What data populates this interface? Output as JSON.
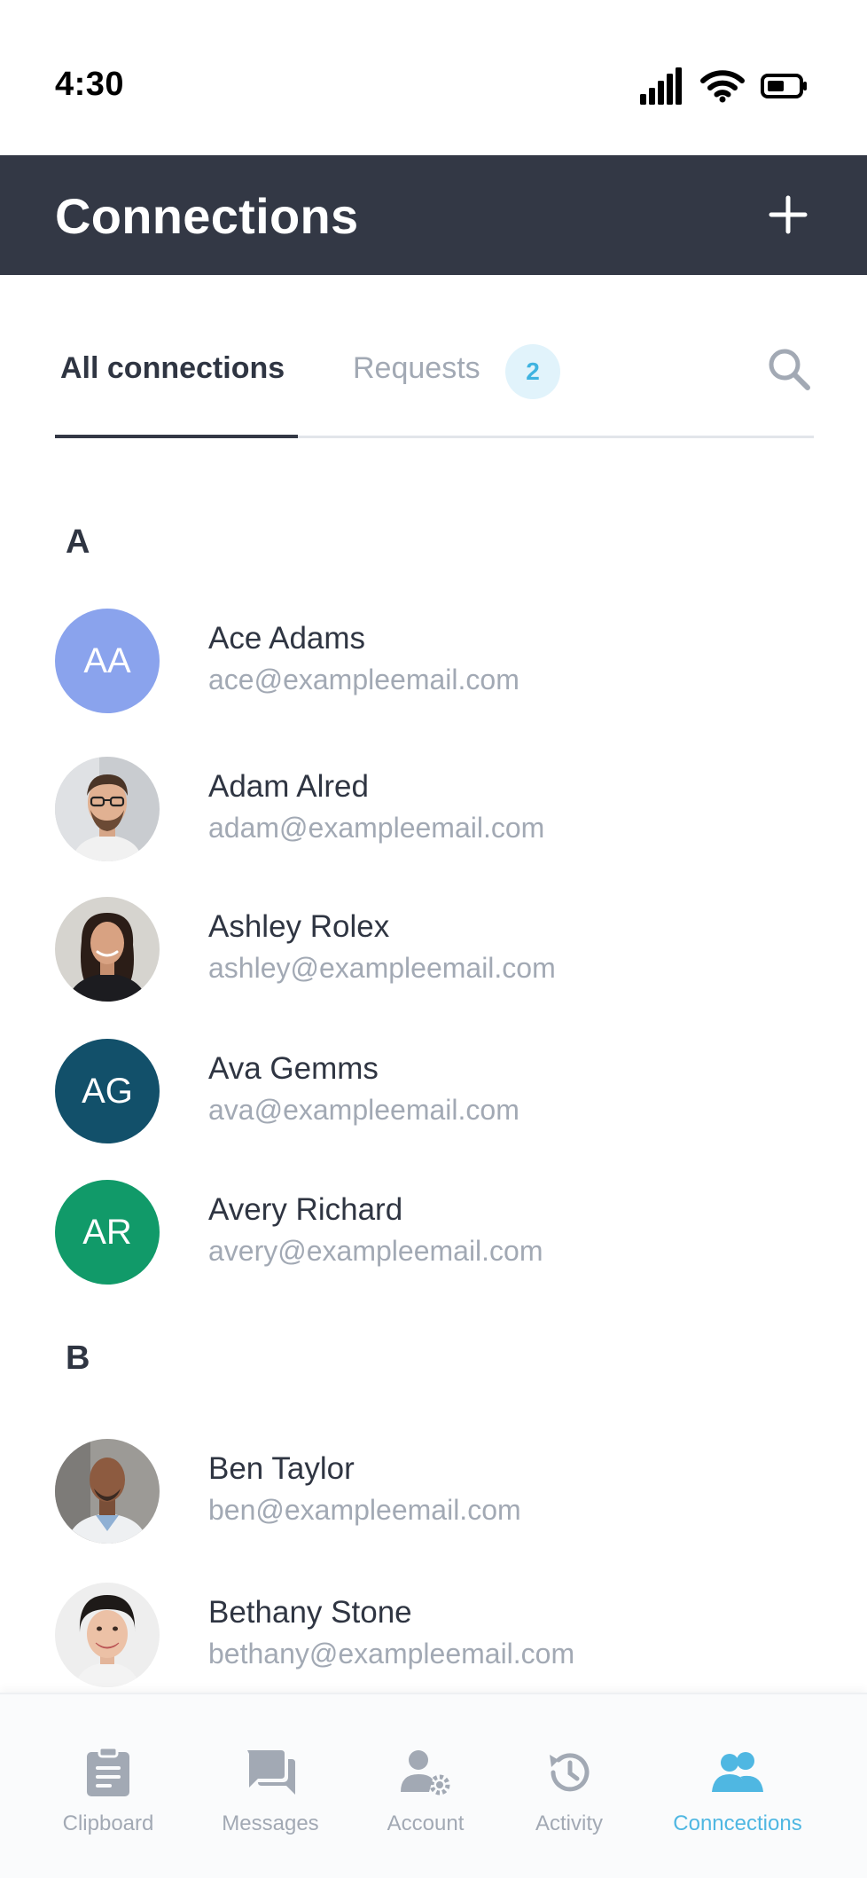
{
  "status_bar": {
    "time": "4:30"
  },
  "header": {
    "title": "Connections",
    "add_icon": "plus-icon"
  },
  "tabs": {
    "all_label": "All connections",
    "requests_label": "Requests",
    "requests_count": "2",
    "search_icon": "search-icon"
  },
  "sections": [
    {
      "letter": "A",
      "contacts": [
        {
          "name": "Ace Adams",
          "email": "ace@exampleemail.com",
          "initials": "AA",
          "avatar_color": "#8aa3ed"
        },
        {
          "name": "Adam Alred",
          "email": "adam@exampleemail.com",
          "avatar": "photo"
        },
        {
          "name": "Ashley Rolex",
          "email": "ashley@exampleemail.com",
          "avatar": "photo"
        },
        {
          "name": "Ava Gemms",
          "email": "ava@exampleemail.com",
          "initials": "AG",
          "avatar_color": "#12506a"
        },
        {
          "name": "Avery Richard",
          "email": "avery@exampleemail.com",
          "initials": "AR",
          "avatar_color": "#119a69"
        }
      ]
    },
    {
      "letter": "B",
      "contacts": [
        {
          "name": "Ben Taylor",
          "email": "ben@exampleemail.com",
          "avatar": "photo"
        },
        {
          "name": "Bethany Stone",
          "email": "bethany@exampleemail.com",
          "avatar": "photo"
        }
      ]
    }
  ],
  "bottom_nav": {
    "items": [
      {
        "label": "Clipboard",
        "icon": "clipboard-icon"
      },
      {
        "label": "Messages",
        "icon": "messages-icon"
      },
      {
        "label": "Account",
        "icon": "account-settings-icon"
      },
      {
        "label": "Activity",
        "icon": "history-icon"
      },
      {
        "label": "Conncections",
        "icon": "people-icon"
      }
    ],
    "active_index": 4
  },
  "colors": {
    "header_bg": "#333845",
    "accent": "#4fb7e2",
    "muted_text": "#a2a9b4"
  }
}
